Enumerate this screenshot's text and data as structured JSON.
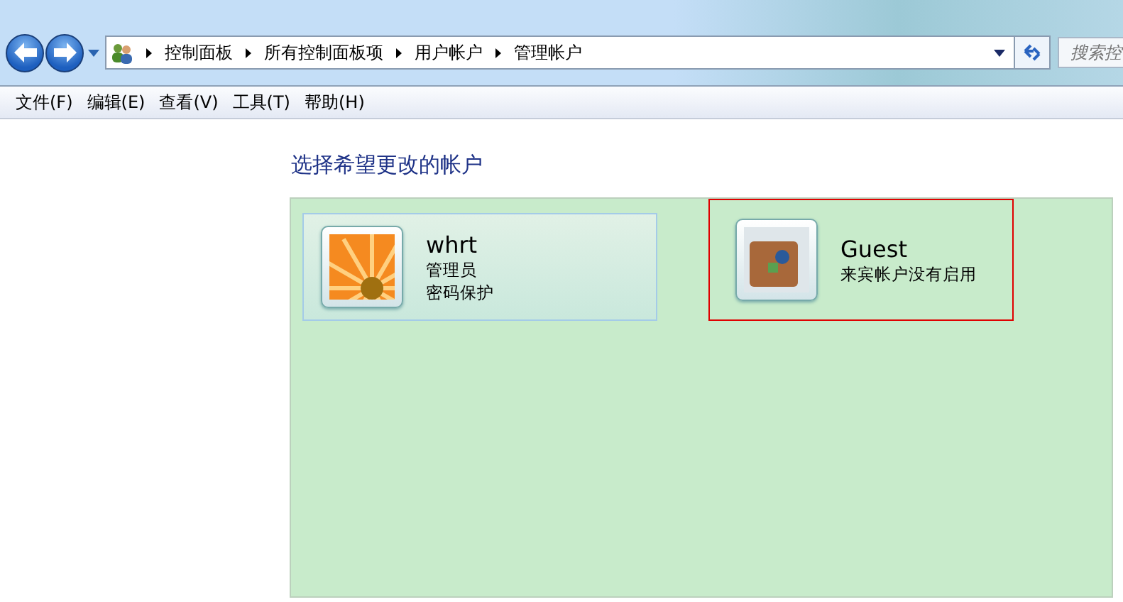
{
  "breadcrumb": [
    "控制面板",
    "所有控制面板项",
    "用户帐户",
    "管理帐户"
  ],
  "search": {
    "placeholder": "搜索控"
  },
  "menu": [
    "文件(F)",
    "编辑(E)",
    "查看(V)",
    "工具(T)",
    "帮助(H)"
  ],
  "heading": "选择希望更改的帐户",
  "accounts": [
    {
      "name": "whrt",
      "kind": "flower",
      "details": [
        "管理员",
        "密码保护"
      ],
      "selected": true,
      "outlined": false
    },
    {
      "name": "Guest",
      "kind": "suitcase",
      "details": [
        "来宾帐户没有启用"
      ],
      "selected": false,
      "outlined": true
    }
  ]
}
